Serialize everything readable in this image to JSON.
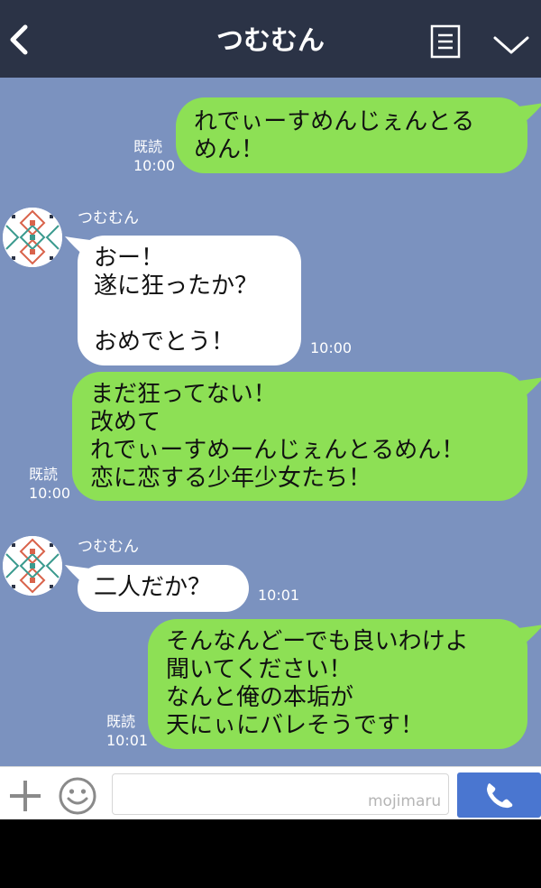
{
  "header": {
    "title": "つむむん",
    "icons": {
      "back": "chevron-left-icon",
      "menu": "document-list-icon",
      "expand": "chevron-down-icon"
    }
  },
  "messages": [
    {
      "type": "outgoing",
      "text": "れでぃーすめんじぇんとる\nめん！",
      "read_label": "既読",
      "time": "10:00"
    },
    {
      "type": "incoming",
      "sender": "つむむん",
      "text": "おー！\n遂に狂ったか？\n\nおめでとう！",
      "time": "10:00"
    },
    {
      "type": "outgoing",
      "text": "まだ狂ってない！\n改めて\nれでぃーすめーんじぇんとるめん！\n恋に恋する少年少女たち！",
      "read_label": "既読",
      "time": "10:00"
    },
    {
      "type": "incoming",
      "sender": "つむむん",
      "text": "二人だか？",
      "time": "10:01"
    },
    {
      "type": "outgoing",
      "text": "そんなんどーでも良いわけよ\n聞いてください！\nなんと俺の本垢が\n天にぃにバレそうです！",
      "read_label": "既読",
      "time": "10:01"
    }
  ],
  "input_bar": {
    "placeholder": "",
    "watermark": "mojimaru",
    "icons": {
      "add": "plus-icon",
      "emoji": "smiley-icon",
      "call": "phone-icon"
    }
  },
  "colors": {
    "header_bg": "#2b3346",
    "chat_bg": "#7b92bf",
    "outgoing_bubble": "#8de055",
    "incoming_bubble": "#ffffff",
    "call_button": "#4a76d0"
  }
}
